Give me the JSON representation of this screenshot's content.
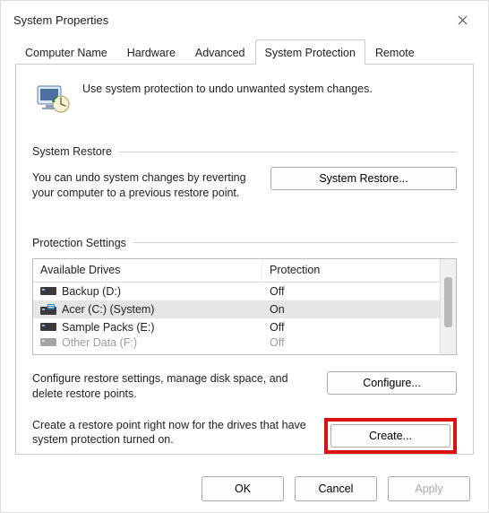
{
  "window": {
    "title": "System Properties"
  },
  "tabs": {
    "computer_name": "Computer Name",
    "hardware": "Hardware",
    "advanced": "Advanced",
    "system_protection": "System Protection",
    "remote": "Remote"
  },
  "intro": {
    "text": "Use system protection to undo unwanted system changes."
  },
  "system_restore": {
    "heading": "System Restore",
    "desc": "You can undo system changes by reverting your computer to a previous restore point.",
    "button": "System Restore..."
  },
  "protection_settings": {
    "heading": "Protection Settings",
    "columns": {
      "drives": "Available Drives",
      "protection": "Protection"
    },
    "rows": [
      {
        "name": "Backup (D:)",
        "protection": "Off",
        "selected": false,
        "system": false
      },
      {
        "name": "Acer (C:) (System)",
        "protection": "On",
        "selected": true,
        "system": true
      },
      {
        "name": "Sample Packs (E:)",
        "protection": "Off",
        "selected": false,
        "system": false
      },
      {
        "name": "Other Data (F:)",
        "protection": "Off",
        "selected": false,
        "system": false
      }
    ],
    "configure": {
      "desc": "Configure restore settings, manage disk space, and delete restore points.",
      "button": "Configure..."
    },
    "create": {
      "desc": "Create a restore point right now for the drives that have system protection turned on.",
      "button": "Create..."
    }
  },
  "footer": {
    "ok": "OK",
    "cancel": "Cancel",
    "apply": "Apply"
  }
}
